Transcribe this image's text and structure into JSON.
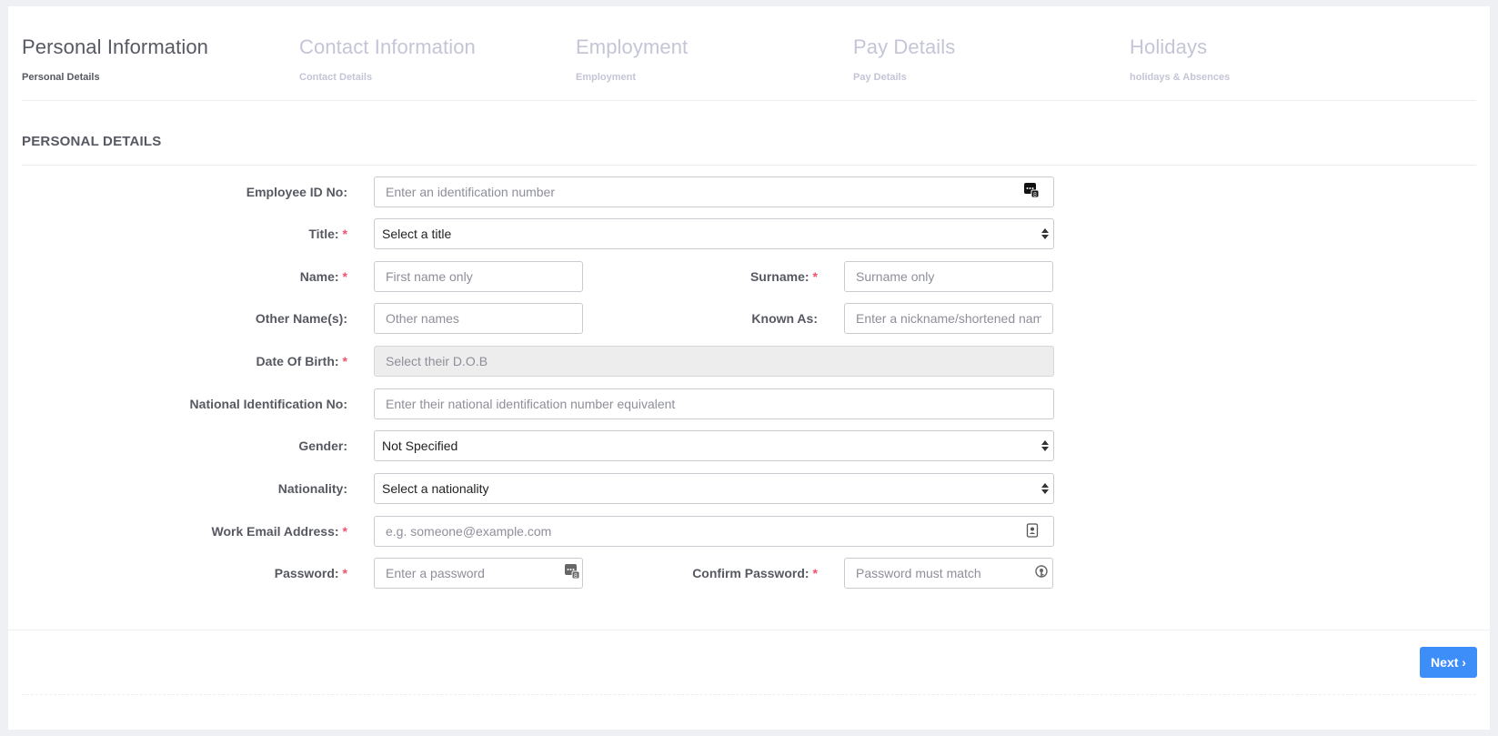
{
  "wizard": {
    "steps": [
      {
        "title": "Personal Information",
        "subtitle": "Personal Details",
        "active": true
      },
      {
        "title": "Contact Information",
        "subtitle": "Contact Details",
        "active": false
      },
      {
        "title": "Employment",
        "subtitle": "Employment",
        "active": false
      },
      {
        "title": "Pay Details",
        "subtitle": "Pay Details",
        "active": false
      },
      {
        "title": "Holidays",
        "subtitle": "holidays & Absences",
        "active": false
      }
    ]
  },
  "section": {
    "title": "PERSONAL DETAILS"
  },
  "form": {
    "employee_id": {
      "label": "Employee ID No:",
      "placeholder": "Enter an identification number",
      "icon": "keypad-icon"
    },
    "title": {
      "label": "Title:",
      "required": "*",
      "value": "Select a title"
    },
    "name": {
      "label": "Name:",
      "required": "*",
      "placeholder": "First name only"
    },
    "surname": {
      "label": "Surname:",
      "required": "*",
      "placeholder": "Surname only"
    },
    "other_names": {
      "label": "Other Name(s):",
      "placeholder": "Other names"
    },
    "known_as": {
      "label": "Known As:",
      "placeholder": "Enter a nickname/shortened name"
    },
    "dob": {
      "label": "Date Of Birth:",
      "required": "*",
      "placeholder": "Select their D.O.B"
    },
    "national_id": {
      "label": "National Identification No:",
      "placeholder": "Enter their national identification number equivalent"
    },
    "gender": {
      "label": "Gender:",
      "value": "Not Specified"
    },
    "nationality": {
      "label": "Nationality:",
      "value": "Select a nationality"
    },
    "work_email": {
      "label": "Work Email Address:",
      "required": "*",
      "placeholder": "e.g. someone@example.com",
      "icon": "contact-card-icon"
    },
    "password": {
      "label": "Password:",
      "required": "*",
      "placeholder": "Enter a password",
      "icon": "keypad-icon"
    },
    "confirm_password": {
      "label": "Confirm Password:",
      "required": "*",
      "placeholder": "Password must match",
      "icon": "key-icon"
    }
  },
  "footer": {
    "next_label": "Next ›"
  },
  "colors": {
    "accent": "#3d8ef8",
    "required": "#f4516c",
    "text": "#575962",
    "muted": "#c4c5d6"
  }
}
